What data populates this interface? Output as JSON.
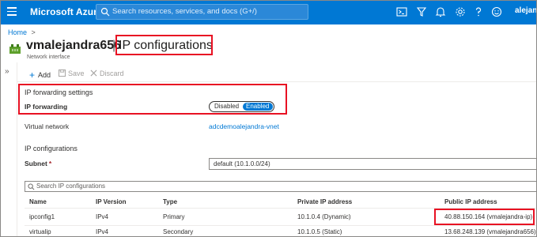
{
  "topbar": {
    "brand": "Microsoft Azure",
    "search_placeholder": "Search resources, services, and docs (G+/)",
    "user": "alejan",
    "icons": [
      "menu-icon",
      "cloud-shell-icon",
      "directory-filter-icon",
      "notifications-icon",
      "settings-icon",
      "help-icon",
      "feedback-icon"
    ]
  },
  "breadcrumb": {
    "home": "Home",
    "separator": ">"
  },
  "header": {
    "resource_name": "vmalejandra656",
    "separator": "|",
    "blade_title": "IP configurations",
    "subtitle": "Network interface"
  },
  "left_strip": {
    "expand": "»"
  },
  "toolbar": {
    "add": "Add",
    "save": "Save",
    "discard": "Discard"
  },
  "ip_forwarding": {
    "section_title": "IP forwarding settings",
    "label": "IP forwarding",
    "toggle_off": "Disabled",
    "toggle_on": "Enabled",
    "selected": "Enabled"
  },
  "virtual_network": {
    "label": "Virtual network",
    "value": "adcdemoalejandra-vnet"
  },
  "ip_configurations": {
    "section_title": "IP configurations",
    "subnet_label": "Subnet",
    "subnet_required": "*",
    "subnet_value": "default (10.1.0.0/24)",
    "filter_placeholder": "Search IP configurations",
    "columns": [
      "Name",
      "IP Version",
      "Type",
      "Private IP address",
      "Public IP address"
    ],
    "rows": [
      [
        "ipconfig1",
        "IPv4",
        "Primary",
        "10.1.0.4 (Dynamic)",
        "40.88.150.164 (vmalejandra-ip)"
      ],
      [
        "virtualip",
        "IPv4",
        "Secondary",
        "10.1.0.5 (Static)",
        "13.68.248.139 (vmalejandra656)"
      ]
    ]
  },
  "colors": {
    "accent": "#0078d4",
    "highlight": "#e81123"
  }
}
